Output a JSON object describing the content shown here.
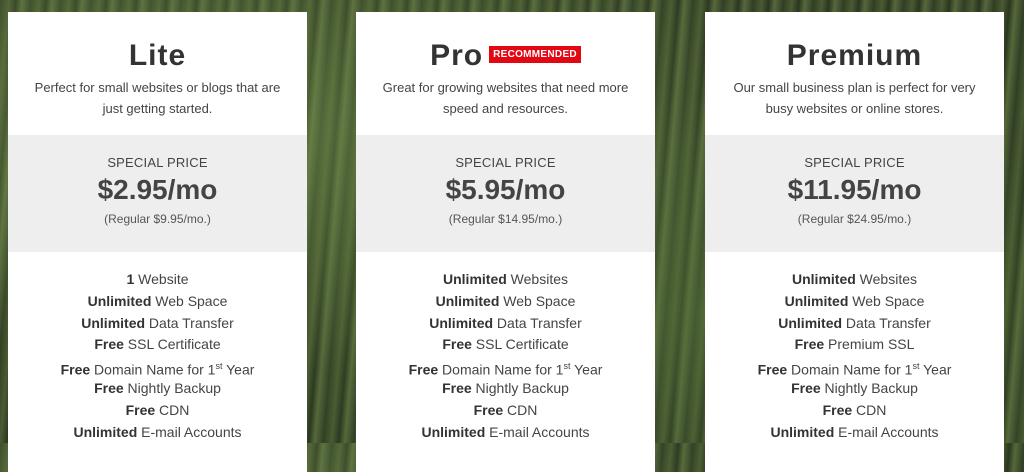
{
  "plans": [
    {
      "name": "Lite",
      "badge": "",
      "description": "Perfect for small websites or blogs that are just getting started.",
      "special_label": "SPECIAL PRICE",
      "price": "$2.95/mo",
      "regular": "(Regular $9.95/mo.)",
      "features": [
        {
          "bold": "1",
          "text": " Website"
        },
        {
          "bold": "Unlimited",
          "text": " Web Space"
        },
        {
          "bold": "Unlimited",
          "text": " Data Transfer"
        },
        {
          "bold": "Free",
          "text": " SSL Certificate"
        },
        {
          "bold": "Free",
          "text": " Domain Name for 1",
          "sup": "st",
          "after": " Year"
        },
        {
          "bold": "Free",
          "text": " Nightly Backup"
        },
        {
          "bold": "Free",
          "text": " CDN"
        },
        {
          "bold": "Unlimited",
          "text": " E-mail Accounts"
        }
      ]
    },
    {
      "name": "Pro",
      "badge": "RECOMMENDED",
      "description": "Great for growing websites that need more speed and resources.",
      "special_label": "SPECIAL PRICE",
      "price": "$5.95/mo",
      "regular": "(Regular $14.95/mo.)",
      "features": [
        {
          "bold": "Unlimited",
          "text": " Websites"
        },
        {
          "bold": "Unlimited",
          "text": " Web Space"
        },
        {
          "bold": "Unlimited",
          "text": " Data Transfer"
        },
        {
          "bold": "Free",
          "text": " SSL Certificate"
        },
        {
          "bold": "Free",
          "text": " Domain Name for 1",
          "sup": "st",
          "after": " Year"
        },
        {
          "bold": "Free",
          "text": " Nightly Backup"
        },
        {
          "bold": "Free",
          "text": " CDN"
        },
        {
          "bold": "Unlimited",
          "text": " E-mail Accounts"
        }
      ]
    },
    {
      "name": "Premium",
      "badge": "",
      "description": "Our small business plan is perfect for very busy websites or online stores.",
      "special_label": "SPECIAL PRICE",
      "price": "$11.95/mo",
      "regular": "(Regular $24.95/mo.)",
      "features": [
        {
          "bold": "Unlimited",
          "text": " Websites"
        },
        {
          "bold": "Unlimited",
          "text": " Web Space"
        },
        {
          "bold": "Unlimited",
          "text": " Data Transfer"
        },
        {
          "bold": "Free",
          "text": " Premium SSL"
        },
        {
          "bold": "Free",
          "text": " Domain Name for 1",
          "sup": "st",
          "after": " Year"
        },
        {
          "bold": "Free",
          "text": " Nightly Backup"
        },
        {
          "bold": "Free",
          "text": " CDN"
        },
        {
          "bold": "Unlimited",
          "text": " E-mail Accounts"
        }
      ]
    }
  ],
  "colors": {
    "badge": "#e30613",
    "price_band": "#eeeeee",
    "card": "#ffffff",
    "text": "#444444"
  }
}
